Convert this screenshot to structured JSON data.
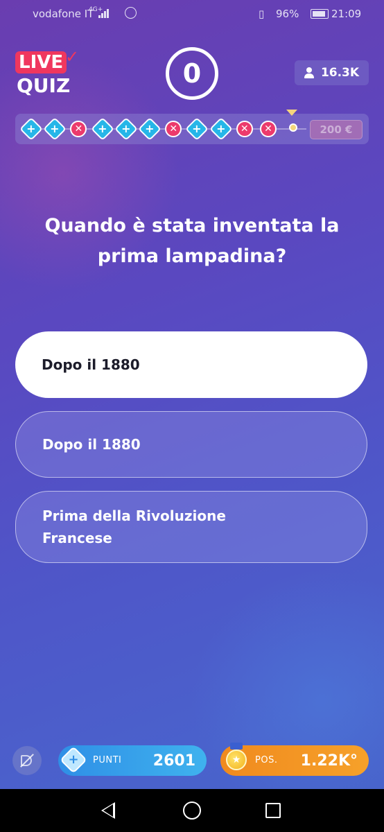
{
  "status_bar": {
    "carrier": "vodafone IT",
    "network": "4G+",
    "battery": "96%",
    "time": "21:09"
  },
  "header": {
    "logo_live": "LIVE",
    "logo_quiz": "QUIZ",
    "counter": "0",
    "viewers": "16.3K"
  },
  "progress": {
    "steps": [
      "plus",
      "plus",
      "x",
      "plus",
      "plus",
      "plus",
      "x",
      "plus",
      "plus",
      "x",
      "x"
    ],
    "prize": "200 €"
  },
  "question": "Quando è stata inventata la prima lampadina?",
  "answers": [
    {
      "label": "Dopo il 1880",
      "selected": true
    },
    {
      "label": "Dopo il 1880",
      "selected": false
    },
    {
      "label": "Prima della Rivoluzione\nFrancese",
      "selected": false
    }
  ],
  "bottom_bar": {
    "points_label": "PUNTI",
    "points_value": "2601",
    "position_label": "POS.",
    "position_value": "1.22K°"
  },
  "colors": {
    "accent_live": "#f0375e",
    "correct": "#26b6e8",
    "wrong": "#ec3a6c",
    "points_pill": "#2f8fe6",
    "position_pill": "#f08a1e"
  }
}
